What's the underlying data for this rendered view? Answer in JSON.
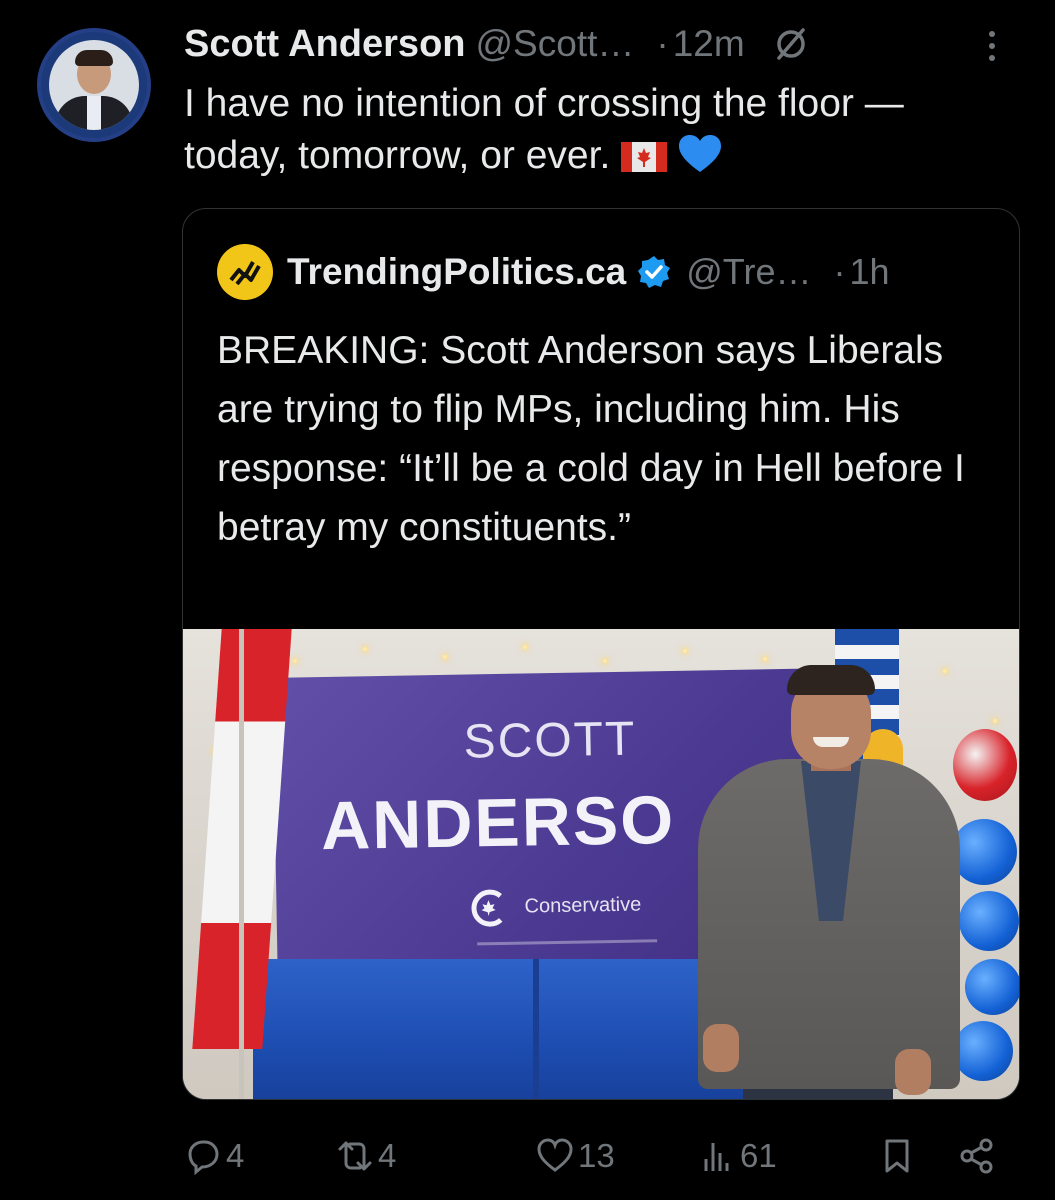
{
  "post": {
    "author_name": "Scott Anderson",
    "author_handle": "@Scott…",
    "dot": "·",
    "time": "12m",
    "text_line1": "I have no intention of crossing the floor —",
    "text_line2": "today, tomorrow, or ever."
  },
  "quote": {
    "name": "TrendingPolitics.ca",
    "handle": "@Tre…",
    "dot": "·",
    "time": "1h",
    "text": "BREAKING: Scott Anderson says Liberals are trying to flip MPs, including him. His response: “It’ll be a cold day in Hell before I betray my constituents.”",
    "image": {
      "banner_first": "SCOTT",
      "banner_last": "ANDERSO",
      "party": "Conservative"
    }
  },
  "actions": {
    "replies": "4",
    "reposts": "4",
    "likes": "13",
    "views": "61"
  },
  "colors": {
    "background": "#000000",
    "text_primary": "#e7e9ea",
    "text_secondary": "#71767b",
    "verified": "#1d9bf0",
    "border": "#2f3336"
  },
  "icons": [
    "grok-icon",
    "more-icon",
    "verified-badge-icon",
    "reply-icon",
    "repost-icon",
    "like-icon",
    "views-icon",
    "bookmark-icon",
    "share-icon"
  ]
}
